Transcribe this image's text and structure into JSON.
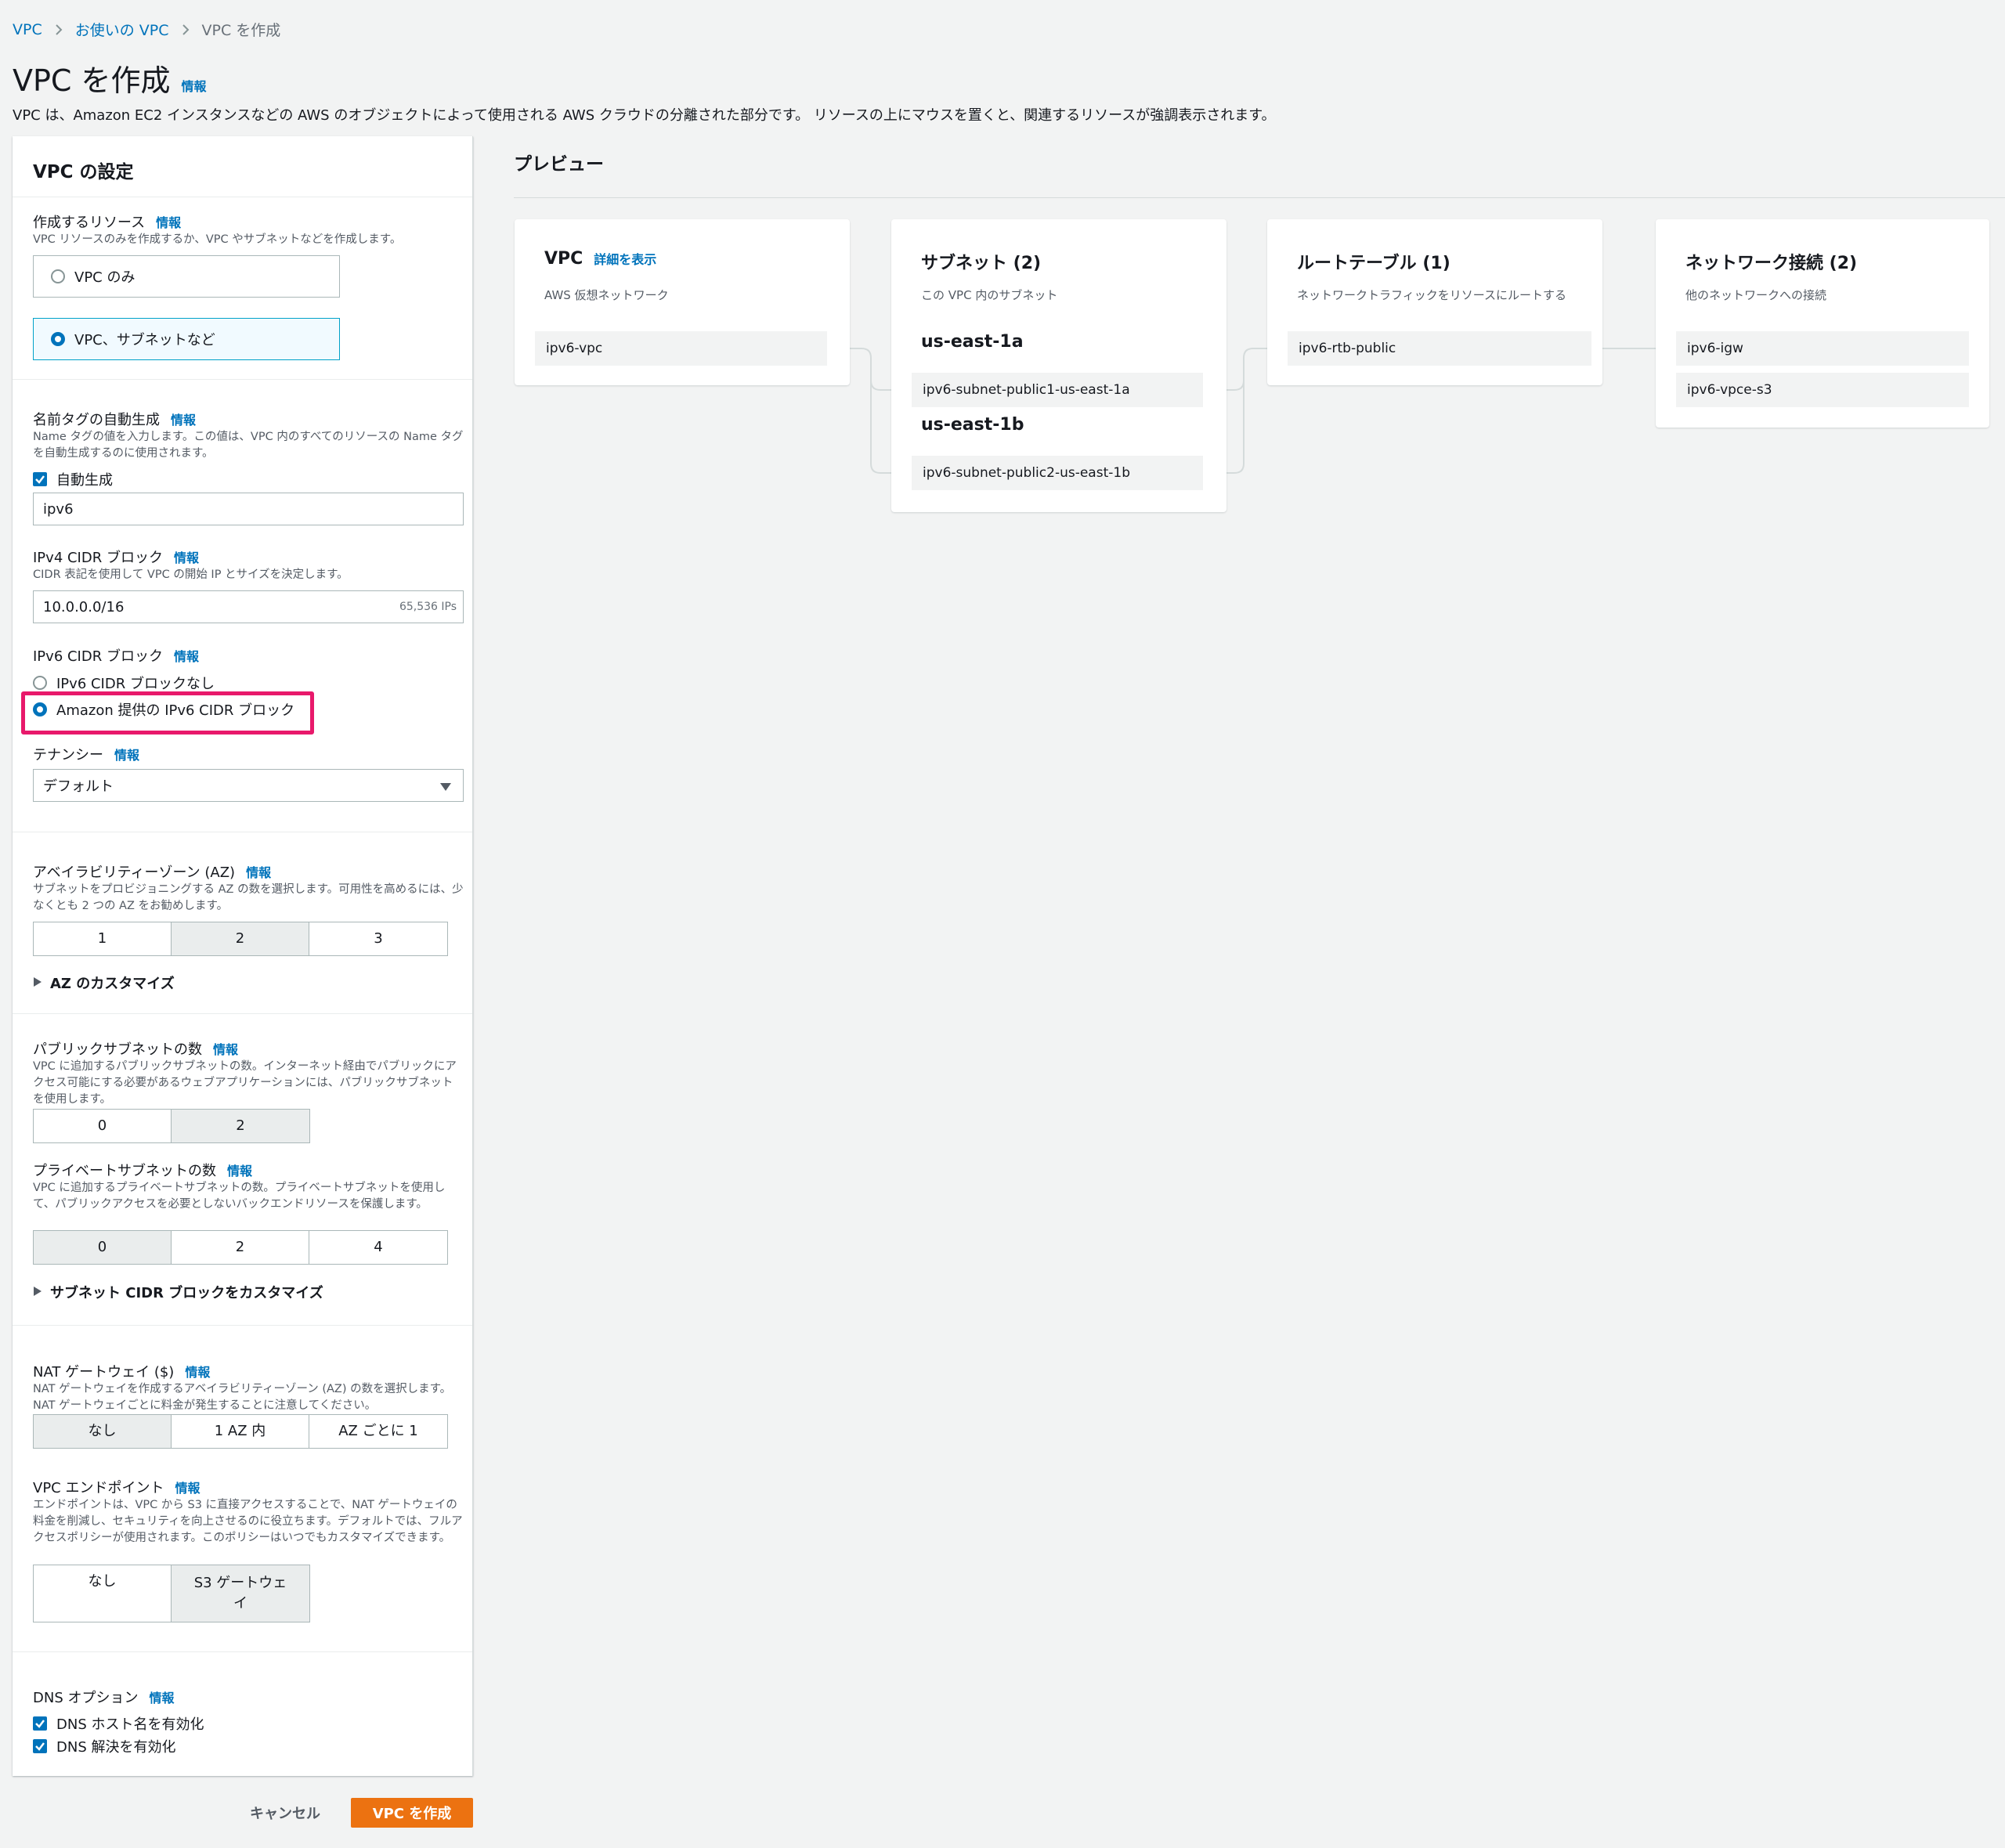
{
  "breadcrumb": {
    "items": [
      "VPC",
      "お使いの VPC"
    ],
    "current": "VPC を作成"
  },
  "page": {
    "title": "VPC を作成",
    "info": "情報",
    "description": "VPC は、Amazon EC2 インスタンスなどの AWS のオブジェクトによって使用される AWS クラウドの分離された部分です。 リソースの上にマウスを置くと、関連するリソースが強調表示されます。"
  },
  "settings": {
    "title": "VPC の設定",
    "info": "情報",
    "resources": {
      "label": "作成するリソース",
      "desc": "VPC リソースのみを作成するか、VPC やサブネットなどを作成します。",
      "options": [
        "VPC のみ",
        "VPC、サブネットなど"
      ],
      "selected": "VPC、サブネットなど"
    },
    "name_tag": {
      "label": "名前タグの自動生成",
      "desc": "Name タグの値を入力します。この値は、VPC 内のすべてのリソースの Name タグを自動生成するのに使用されます。",
      "checkbox_label": "自動生成",
      "checked": true,
      "value": "ipv6"
    },
    "ipv4": {
      "label": "IPv4 CIDR ブロック",
      "desc": "CIDR 表記を使用して VPC の開始 IP とサイズを決定します。",
      "value": "10.0.0.0/16",
      "suffix": "65,536 IPs"
    },
    "ipv6": {
      "label": "IPv6 CIDR ブロック",
      "options": [
        "IPv6 CIDR ブロックなし",
        "Amazon 提供の IPv6 CIDR ブロック"
      ],
      "selected": "Amazon 提供の IPv6 CIDR ブロック"
    },
    "tenancy": {
      "label": "テナンシー",
      "value": "デフォルト"
    },
    "az": {
      "label": "アベイラビリティーゾーン (AZ)",
      "desc": "サブネットをプロビジョニングする AZ の数を選択します。可用性を高めるには、少なくとも 2 つの AZ をお勧めします。",
      "options": [
        "1",
        "2",
        "3"
      ],
      "selected": "2",
      "customize": "AZ のカスタマイズ"
    },
    "public_subnets": {
      "label": "パブリックサブネットの数",
      "desc": "VPC に追加するパブリックサブネットの数。インターネット経由でパブリックにアクセス可能にする必要があるウェブアプリケーションには、パブリックサブネットを使用します。",
      "options": [
        "0",
        "2"
      ],
      "selected": "2"
    },
    "private_subnets": {
      "label": "プライベートサブネットの数",
      "desc": "VPC に追加するプライベートサブネットの数。プライベートサブネットを使用して、パブリックアクセスを必要としないバックエンドリソースを保護します。",
      "options": [
        "0",
        "2",
        "4"
      ],
      "selected": "0",
      "customize": "サブネット CIDR ブロックをカスタマイズ"
    },
    "nat": {
      "label": "NAT ゲートウェイ ($)",
      "desc": "NAT ゲートウェイを作成するアベイラビリティーゾーン (AZ) の数を選択します。NAT ゲートウェイごとに料金が発生することに注意してください。",
      "options": [
        "なし",
        "1 AZ 内",
        "AZ ごとに 1"
      ],
      "selected": "なし"
    },
    "endpoint": {
      "label": "VPC エンドポイント",
      "desc": "エンドポイントは、VPC から S3 に直接アクセスすることで、NAT ゲートウェイの料金を削減し、セキュリティを向上させるのに役立ちます。デフォルトでは、フルアクセスポリシーが使用されます。このポリシーはいつでもカスタマイズできます。",
      "options": [
        "なし",
        "S3 ゲートウェイ"
      ],
      "selected": "S3 ゲートウェイ"
    },
    "dns": {
      "label": "DNS オプション",
      "options": [
        "DNS ホスト名を有効化",
        "DNS 解決を有効化"
      ],
      "checked": [
        true,
        true
      ]
    }
  },
  "actions": {
    "cancel": "キャンセル",
    "create": "VPC を作成"
  },
  "preview": {
    "title": "プレビュー",
    "vpc": {
      "title": "VPC",
      "details_link": "詳細を表示",
      "subtitle": "AWS 仮想ネットワーク",
      "items": [
        "ipv6-vpc"
      ]
    },
    "subnets": {
      "title": "サブネット (2)",
      "subtitle": "この VPC 内のサブネット",
      "zones": [
        {
          "name": "us-east-1a",
          "subnets": [
            "ipv6-subnet-public1-us-east-1a"
          ]
        },
        {
          "name": "us-east-1b",
          "subnets": [
            "ipv6-subnet-public2-us-east-1b"
          ]
        }
      ]
    },
    "route_tables": {
      "title": "ルートテーブル (1)",
      "subtitle": "ネットワークトラフィックをリソースにルートする",
      "items": [
        "ipv6-rtb-public"
      ]
    },
    "connections": {
      "title": "ネットワーク接続 (2)",
      "subtitle": "他のネットワークへの接続",
      "items": [
        "ipv6-igw",
        "ipv6-vpce-s3"
      ]
    }
  },
  "colors": {
    "link": "#0073bb",
    "primary_button": "#ec7211",
    "highlight": "#e8196b",
    "selected_tile": "#f1faff"
  }
}
